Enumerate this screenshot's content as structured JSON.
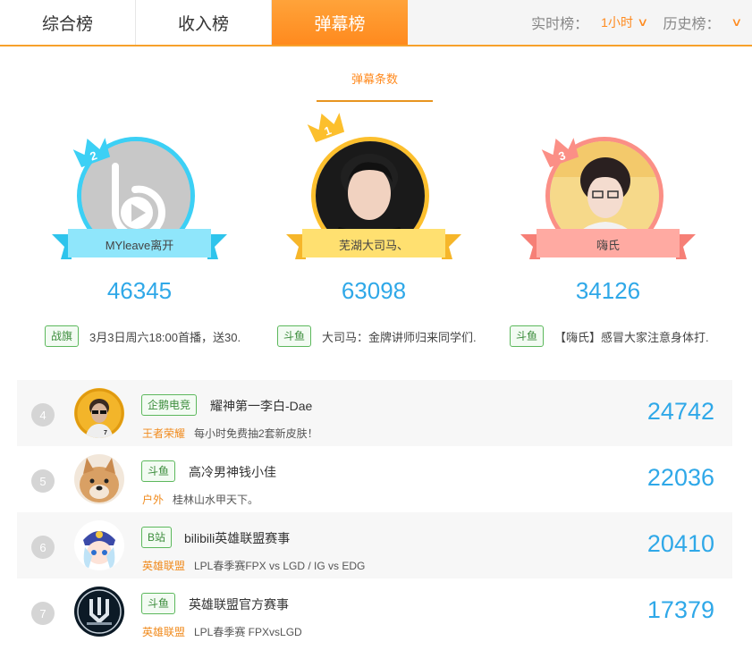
{
  "tabs": [
    {
      "label": "综合榜",
      "active": false
    },
    {
      "label": "收入榜",
      "active": false
    },
    {
      "label": "弹幕榜",
      "active": true
    }
  ],
  "filters": {
    "realtime_label": "实时榜：",
    "realtime_value": "1小时",
    "history_label": "历史榜："
  },
  "subtab": "弹幕条数",
  "podium": [
    {
      "rank": "2",
      "name": "MYleave离开",
      "score": "46345",
      "platform": "战旗",
      "desc": "3月3日周六18:00首播，送30."
    },
    {
      "rank": "1",
      "name": "芜湖大司马、",
      "score": "63098",
      "platform": "斗鱼",
      "desc": "大司马：金牌讲师归来同学们."
    },
    {
      "rank": "3",
      "name": "嗨氏",
      "score": "34126",
      "platform": "斗鱼",
      "desc": "【嗨氏】感冒大家注意身体打."
    }
  ],
  "list": [
    {
      "rank": "4",
      "platform": "企鹅电竞",
      "name": "耀神第一李白-Dae",
      "category": "王者荣耀",
      "desc": "每小时免费抽2套新皮肤！",
      "value": "24742"
    },
    {
      "rank": "5",
      "platform": "斗鱼",
      "name": "高冷男神钱小佳",
      "category": "户外",
      "desc": "桂林山水甲天下。",
      "value": "22036"
    },
    {
      "rank": "6",
      "platform": "B站",
      "name": "bilibili英雄联盟赛事",
      "category": "英雄联盟",
      "desc": "LPL春季赛FPX vs LGD / IG vs EDG",
      "value": "20410"
    },
    {
      "rank": "7",
      "platform": "斗鱼",
      "name": "英雄联盟官方赛事",
      "category": "英雄联盟",
      "desc": "LPL春季赛 FPXvsLGD",
      "value": "17379"
    }
  ],
  "colors": {
    "accent": "#ff8a1e",
    "score_blue": "#2fa8e8",
    "rank2": "#3cd0f5",
    "rank1": "#fcbf2d",
    "rank3": "#fb8f86",
    "tag_green": "#5cb85c",
    "category_orange": "#f08a1c"
  }
}
